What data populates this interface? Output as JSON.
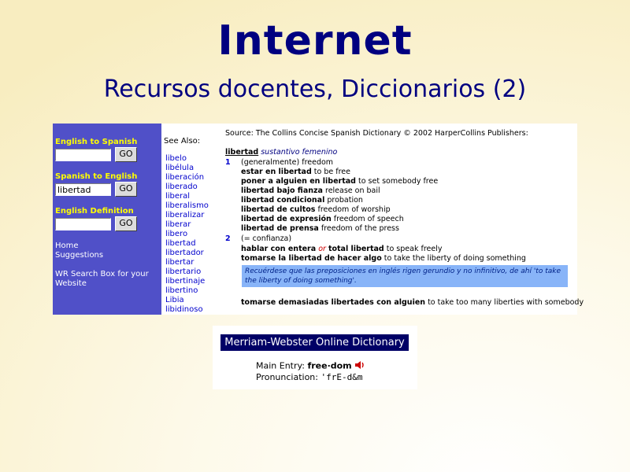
{
  "slide": {
    "title": "Internet",
    "subtitle": "Recursos docentes, Diccionarios (2)"
  },
  "wr": {
    "sections": [
      {
        "label": "English to Spanish",
        "value": "",
        "go": "GO"
      },
      {
        "label": "Spanish to English",
        "value": "libertad",
        "go": "GO"
      },
      {
        "label": "English Definition",
        "value": "",
        "go": "GO"
      }
    ],
    "links": [
      "Home",
      "Suggestions",
      "WR Search Box for your",
      "Website"
    ],
    "see_also_label": "See Also:",
    "see_also": [
      "libelo",
      "libélula",
      "liberación",
      "liberado",
      "liberal",
      "liberalismo",
      "liberalizar",
      "liberar",
      "libero",
      "libertad",
      "libertador",
      "libertar",
      "libertario",
      "libertinaje",
      "libertino",
      "Libia",
      "libidinoso"
    ],
    "source": "Source: The Collins Concise Spanish Dictionary © 2002 HarperCollins Publishers:",
    "headword": "libertad",
    "pos": "sustantivo femenino",
    "sense1_num": "1",
    "sense1_gloss": "(generalmente) freedom",
    "sense1": [
      {
        "es": "estar en libertad",
        "en": "to be free"
      },
      {
        "es": "poner a alguien en libertad",
        "en": "to set somebody free"
      },
      {
        "es": "libertad bajo fianza",
        "en": "release on bail"
      },
      {
        "es": "libertad condicional",
        "en": "probation"
      },
      {
        "es": "libertad de cultos",
        "en": "freedom of worship"
      },
      {
        "es": "libertad de expresión",
        "en": "freedom of speech"
      },
      {
        "es": "libertad de prensa",
        "en": "freedom of the press"
      }
    ],
    "sense2_num": "2",
    "sense2_gloss": "(= confianza)",
    "sense2_a_es1": "hablar con entera",
    "sense2_a_or": "or",
    "sense2_a_es2": "total libertad",
    "sense2_a_en": "to speak freely",
    "sense2_b_es": "tomarse la libertad de hacer algo",
    "sense2_b_en": "to take the liberty of doing something",
    "note_line1": "Recuérdese que las preposiciones en inglés rigen gerundio y no infinitivo, de ahí 'to take",
    "note_line2": "the liberty of doing something'.",
    "last_es": "tomarse demasiadas libertades con alguien",
    "last_en": "to take too many liberties with somebody"
  },
  "mw": {
    "header": "Merriam-Webster Online Dictionary",
    "main_entry_label": "Main Entry:",
    "main_entry_value": "free·dom",
    "pron_label": "Pronunciation:",
    "pron_value": "'frE-d&m",
    "speaker_icon": "speaker-icon"
  },
  "colors": {
    "title": "#000080",
    "wr_sidebar": "#5050c8",
    "wr_label": "#ffff00",
    "link": "#0000cc",
    "note_bg": "#88b4f8",
    "mw_header": "#000066"
  }
}
